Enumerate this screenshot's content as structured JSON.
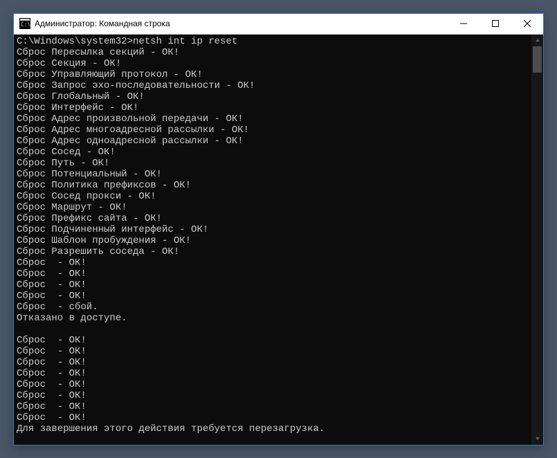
{
  "window": {
    "title": "Администратор: Командная строка"
  },
  "console": {
    "prompt": "C:\\Windows\\system32>",
    "command": "netsh int ip reset",
    "lines": [
      "Сброс Пересылка секций - ОК!",
      "Сброс Секция - ОК!",
      "Сброс Управляющий протокол - ОК!",
      "Сброс Запрос эхо-последовательности - ОК!",
      "Сброс Глобальный - ОК!",
      "Сброс Интерфейс - ОК!",
      "Сброс Адрес произвольной передачи - ОК!",
      "Сброс Адрес многоадресной рассылки - ОК!",
      "Сброс Адрес одноадресной рассылки - ОК!",
      "Сброс Сосед - ОК!",
      "Сброс Путь - ОК!",
      "Сброс Потенциальный - ОК!",
      "Сброс Политика префиксов - ОК!",
      "Сброс Сосед прокси - ОК!",
      "Сброс Маршрут - ОК!",
      "Сброс Префикс сайта - ОК!",
      "Сброс Подчиненный интерфейс - ОК!",
      "Сброс Шаблон пробуждения - ОК!",
      "Сброс Разрешить соседа - ОК!",
      "Сброс  - ОК!",
      "Сброс  - ОК!",
      "Сброс  - ОК!",
      "Сброс  - ОК!",
      "Сброс  - сбой.",
      "Отказано в доступе.",
      "",
      "Сброс  - ОК!",
      "Сброс  - ОК!",
      "Сброс  - ОК!",
      "Сброс  - ОК!",
      "Сброс  - ОК!",
      "Сброс  - ОК!",
      "Сброс  - ОК!",
      "Сброс  - ОК!",
      "Для завершения этого действия требуется перезагрузка.",
      ""
    ]
  }
}
